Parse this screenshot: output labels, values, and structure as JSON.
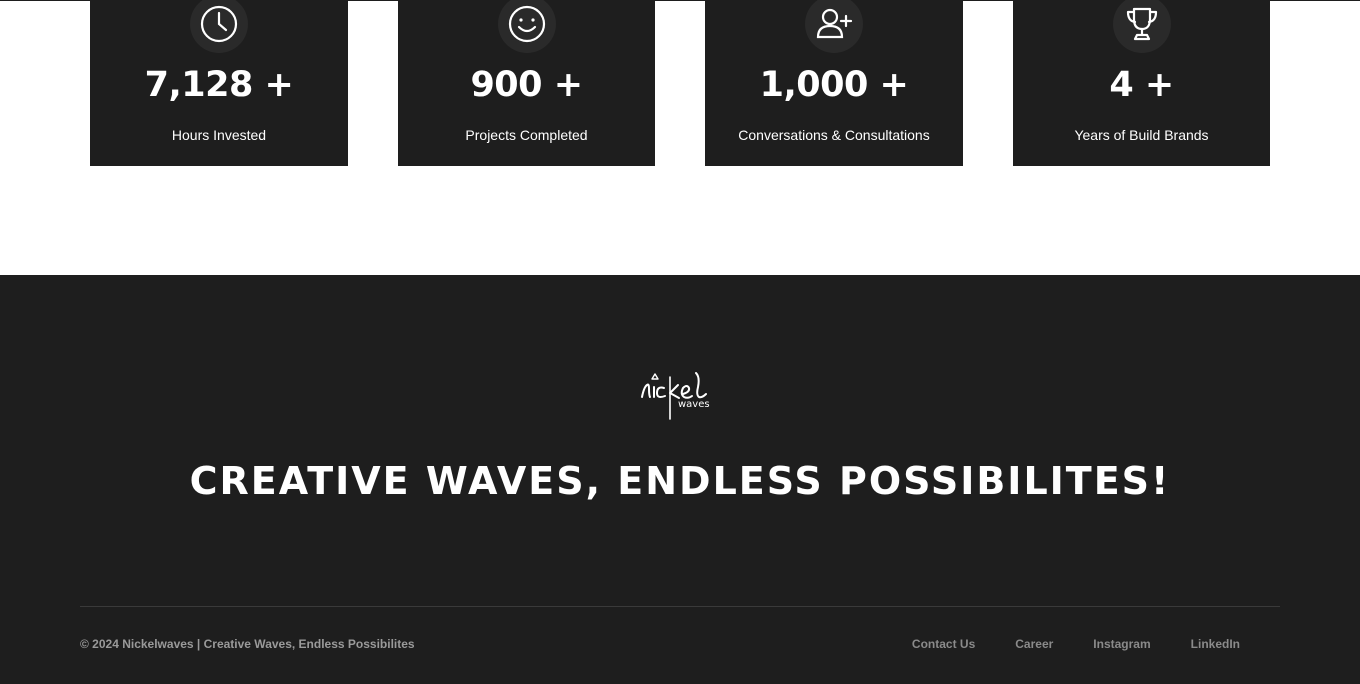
{
  "stats": [
    {
      "icon": "clock-icon",
      "value": "7,128 +",
      "label": "Hours Invested"
    },
    {
      "icon": "smile-icon",
      "value": "900 +",
      "label": "Projects Completed"
    },
    {
      "icon": "add-user-icon",
      "value": "1,000 +",
      "label": "Conversations & Consultations"
    },
    {
      "icon": "trophy-icon",
      "value": "4 +",
      "label": "Years of Build Brands"
    }
  ],
  "footer": {
    "logo_text": "nickel",
    "logo_subtext": "waves",
    "tagline": "CREATIVE WAVES, ENDLESS POSSIBILITES!",
    "copyright": "© 2024 Nickelwaves | Creative Waves, Endless Possibilites",
    "links": [
      "Contact Us",
      "Career",
      "Instagram",
      "LinkedIn"
    ]
  },
  "colors": {
    "background_dark": "#1e1e1e",
    "card_icon_circle": "#2a2a2a",
    "text_light": "#ffffff",
    "text_muted": "#9a9a9a"
  }
}
